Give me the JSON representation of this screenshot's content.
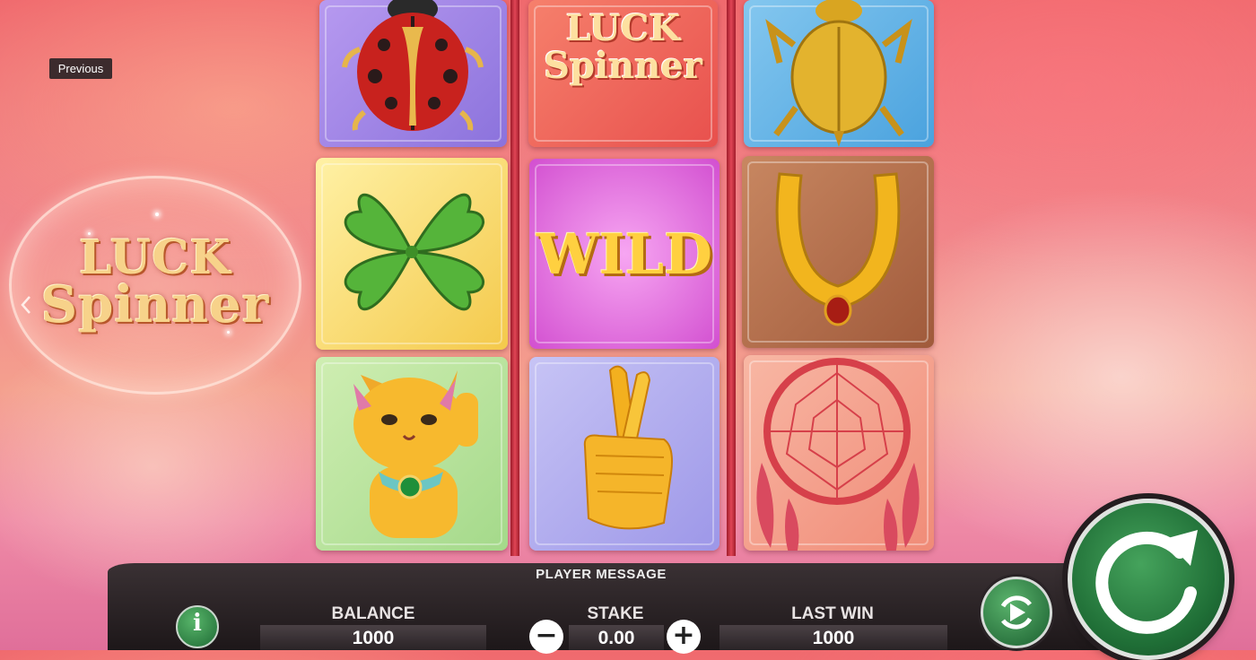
{
  "tooltip": {
    "previous": "Previous"
  },
  "logo": {
    "line1": "LUCK",
    "line2": "Spinner"
  },
  "reels": {
    "reel1": [
      "ladybug",
      "four-leaf-clover",
      "lucky-cat"
    ],
    "reel2": [
      "luck-spinner-logo",
      "wild",
      "crossed-fingers"
    ],
    "reel3": [
      "scarab",
      "horseshoe",
      "dreamcatcher"
    ]
  },
  "reel_logo": {
    "line1": "LUCK",
    "line2": "Spinner"
  },
  "wild_label": "WILD",
  "bottom": {
    "player_message": "PLAYER MESSAGE",
    "balance_label": "BALANCE",
    "balance_value": "1000",
    "stake_label": "STAKE",
    "stake_value": "0.00",
    "last_win_label": "LAST WIN",
    "last_win_value": "1000",
    "minus": "−",
    "plus": "+"
  },
  "colors": {
    "spin_green": "#2f8a4a",
    "reel_divider": "#c6283a",
    "panel": "#231c1e"
  }
}
